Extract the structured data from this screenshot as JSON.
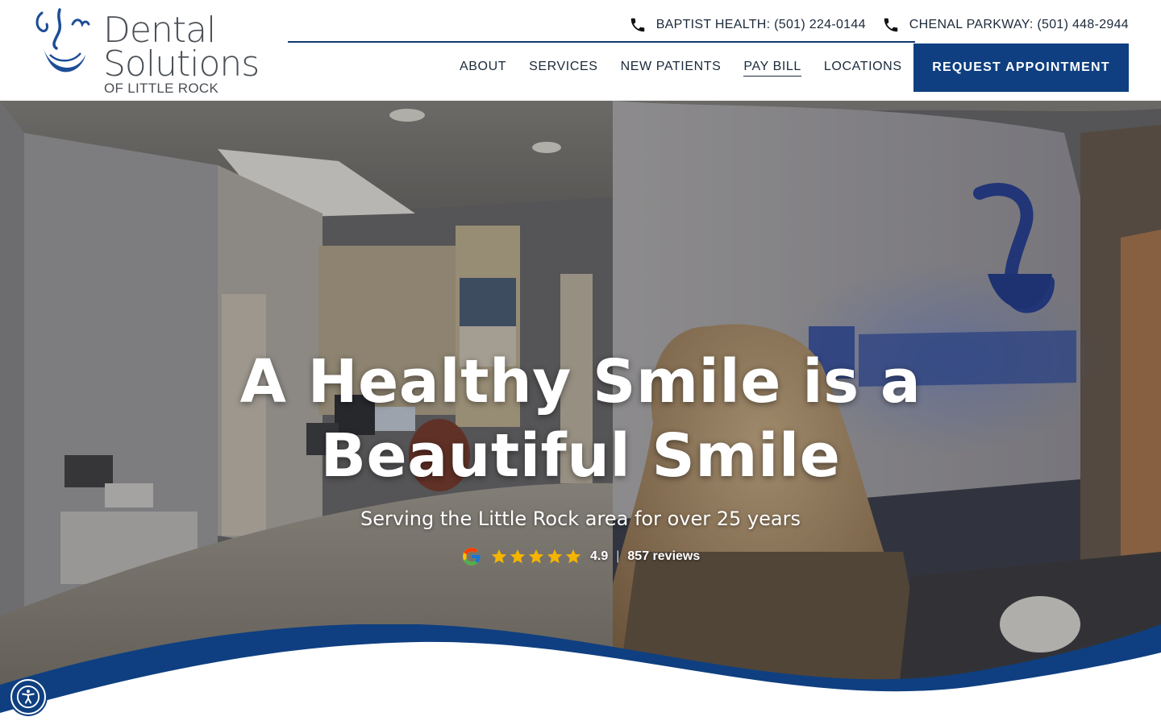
{
  "brand": {
    "name_line1": "Dental",
    "name_line2": "Solutions",
    "tagline": "OF LITTLE ROCK",
    "color_primary": "#0f3f80"
  },
  "header": {
    "phones": [
      {
        "label": "BAPTIST HEALTH: (501) 224-0144",
        "icon": "phone-icon"
      },
      {
        "label": "CHENAL PARKWAY: (501) 448-2944",
        "icon": "phone-icon"
      }
    ],
    "nav": [
      {
        "label": "ABOUT"
      },
      {
        "label": "SERVICES"
      },
      {
        "label": "NEW PATIENTS"
      },
      {
        "label": "PAY BILL"
      },
      {
        "label": "LOCATIONS"
      }
    ],
    "cta_label": "REQUEST APPOINTMENT"
  },
  "hero": {
    "title_line1": "A Healthy Smile is a",
    "title_line2": "Beautiful Smile",
    "subtitle": "Serving the Little Rock area for over 25 years",
    "rating": {
      "source_icon": "google-icon",
      "stars": 5,
      "score": "4.9",
      "separator": "|",
      "reviews": "857 reviews",
      "star_color": "#f5b400"
    }
  },
  "accessibility": {
    "icon": "accessibility-icon"
  }
}
